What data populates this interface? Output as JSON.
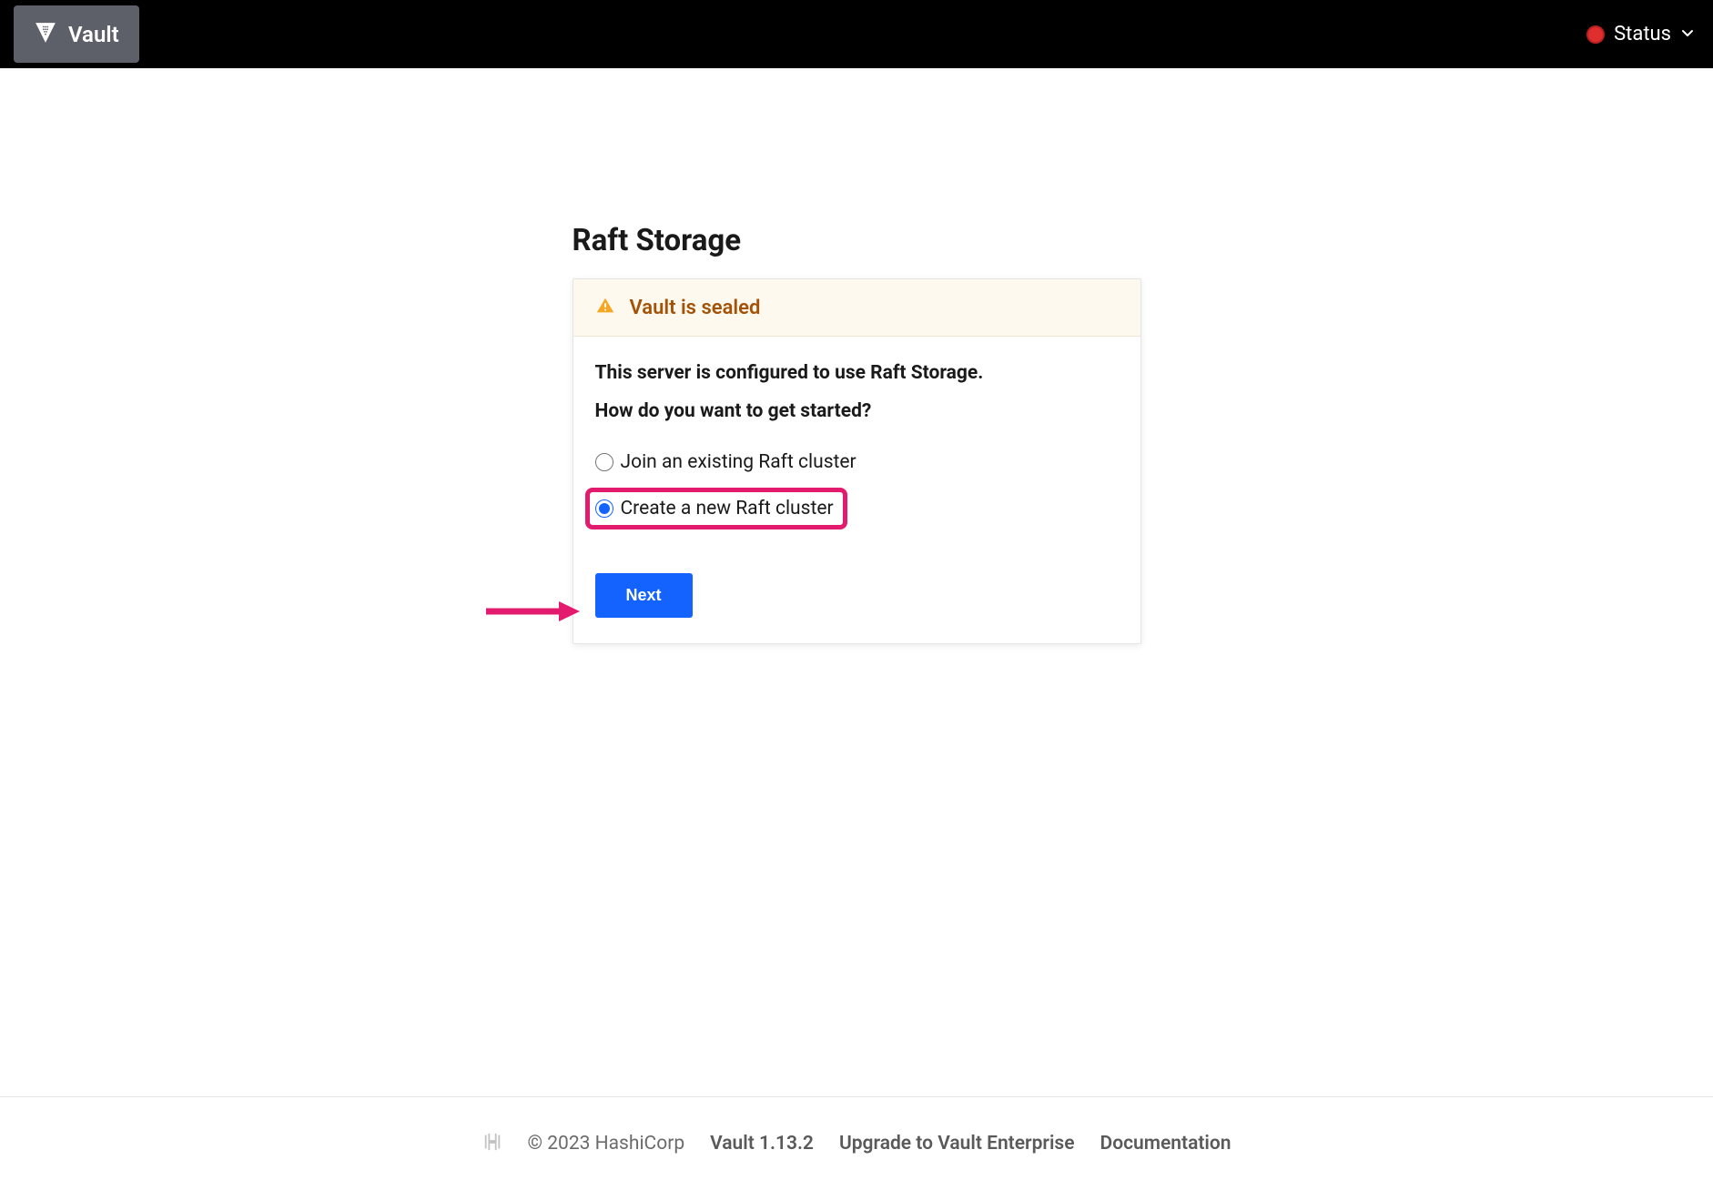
{
  "header": {
    "logo_text": "Vault",
    "status_label": "Status"
  },
  "main": {
    "title": "Raft Storage",
    "alert_message": "Vault is sealed",
    "description": "This server is configured to use Raft Storage.",
    "question": "How do you want to get started?",
    "radio_options": [
      {
        "label": "Join an existing Raft cluster",
        "selected": false
      },
      {
        "label": "Create a new Raft cluster",
        "selected": true
      }
    ],
    "next_button_label": "Next"
  },
  "footer": {
    "copyright": "© 2023 HashiCorp",
    "version": "Vault 1.13.2",
    "upgrade_link": "Upgrade to Vault Enterprise",
    "documentation_link": "Documentation"
  },
  "annotations": {
    "highlight_color": "#e21b6e"
  }
}
